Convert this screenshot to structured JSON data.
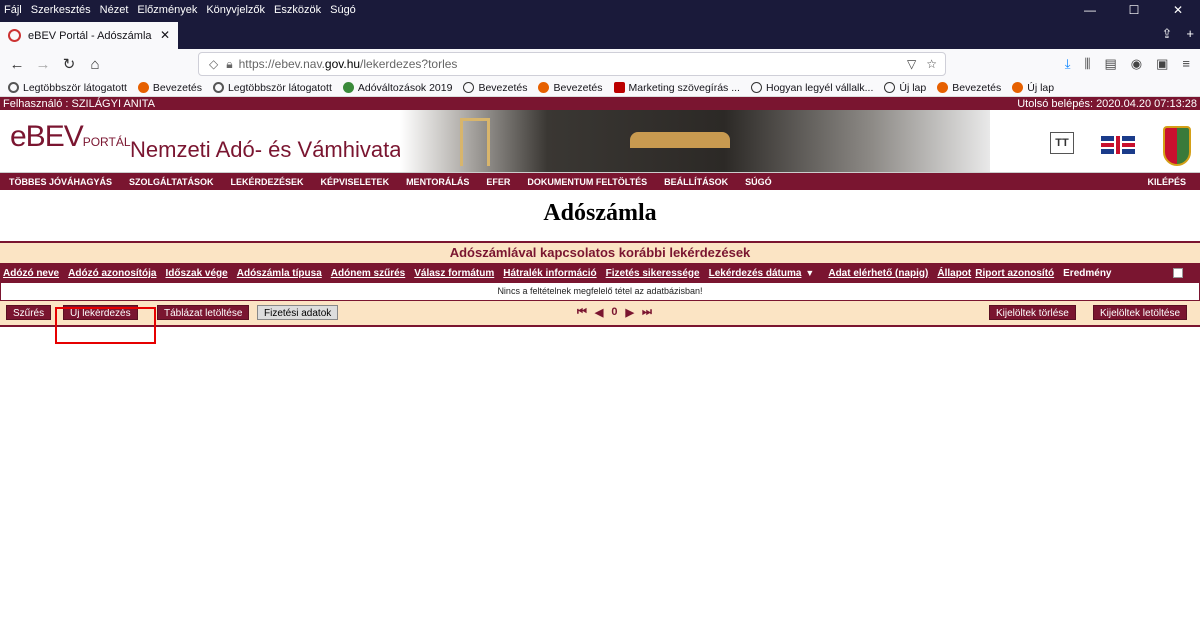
{
  "browser": {
    "menu": [
      "Fájl",
      "Szerkesztés",
      "Nézet",
      "Előzmények",
      "Könyvjelzők",
      "Eszközök",
      "Súgó"
    ],
    "tab_title": "eBEV Portál - Adószámla",
    "url_prefix": "https://ebev.nav.",
    "url_domain": "gov.hu",
    "url_path": "/lekerdezes?torles",
    "bookmarks": [
      "Legtöbbször látogatott",
      "Bevezetés",
      "Legtöbbször látogatott",
      "Adóváltozások 2019",
      "Bevezetés",
      "Bevezetés",
      "Marketing szövegírás ...",
      "Hogyan legyél vállalk...",
      "Új lap",
      "Bevezetés",
      "Új lap"
    ]
  },
  "userbar": {
    "user": "Felhasználó : SZILÁGYI ANITA",
    "last_login": "Utolsó belépés: 2020.04.20 07:13:28"
  },
  "banner": {
    "logo_main": "eBEV",
    "logo_small": "PORTÁL",
    "title": "Nemzeti Adó- és Vámhivatal",
    "text_size_label": "TT"
  },
  "mainmenu": {
    "items": [
      "TÖBBES JÓVÁHAGYÁS",
      "SZOLGÁLTATÁSOK",
      "LEKÉRDEZÉSEK",
      "KÉPVISELETEK",
      "MENTORÁLÁS",
      "EFER",
      "DOKUMENTUM FELTÖLTÉS",
      "BEÁLLÍTÁSOK",
      "SÚGÓ"
    ],
    "logout": "KILÉPÉS"
  },
  "page": {
    "heading": "Adószámla",
    "caption": "Adószámlával kapcsolatos korábbi lekérdezések",
    "columns": [
      "Adózó neve",
      "Adózó azonosítója",
      "Időszak vége",
      "Adószámla típusa",
      "Adónem szűrés",
      "Válasz formátum",
      "Hátralék információ",
      "Fizetés sikeressége",
      "Lekérdezés dátuma",
      "Adat elérhető (napig)",
      "Állapot",
      "Riport azonosító",
      "Eredmény"
    ],
    "empty_message": "Nincs a feltételnek megfelelő tétel az adatbázisban!",
    "buttons": {
      "filter": "Szűrés",
      "new_query": "Új lekérdezés",
      "table_download": "Táblázat letöltése",
      "payment_data": "Fizetési adatok",
      "delete_selected": "Kijelöltek törlése",
      "download_selected": "Kijelöltek letöltése"
    },
    "pager": {
      "page": "0"
    }
  }
}
